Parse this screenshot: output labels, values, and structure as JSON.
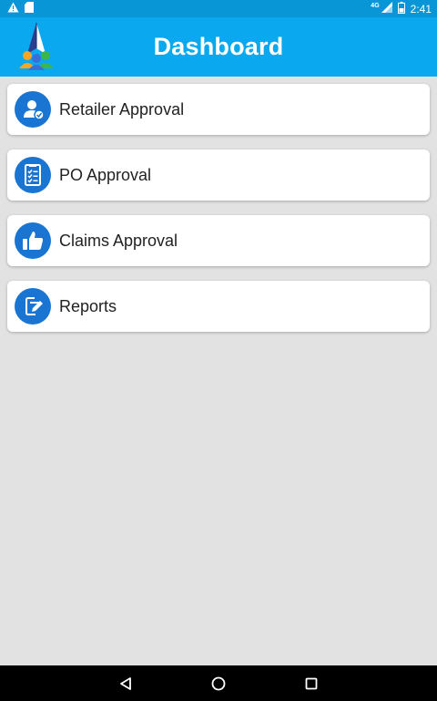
{
  "status_bar": {
    "time": "2:41",
    "network": "4G",
    "icons": [
      "warning-icon",
      "sd-card-icon",
      "signal-icon",
      "battery-icon"
    ]
  },
  "header": {
    "title": "Dashboard",
    "logo_icon": "app-logo-icon"
  },
  "menu": {
    "items": [
      {
        "label": "Retailer Approval",
        "icon": "user-check-icon"
      },
      {
        "label": "PO Approval",
        "icon": "checklist-icon"
      },
      {
        "label": "Claims Approval",
        "icon": "thumbs-up-icon"
      },
      {
        "label": "Reports",
        "icon": "report-edit-icon"
      }
    ]
  },
  "navigation": {
    "buttons": [
      "back-icon",
      "home-icon",
      "recents-icon"
    ]
  },
  "colors": {
    "status_bar": "#0896d6",
    "header": "#0aa8ef",
    "icon_circle": "#1a74d2",
    "background": "#e2e2e2"
  }
}
